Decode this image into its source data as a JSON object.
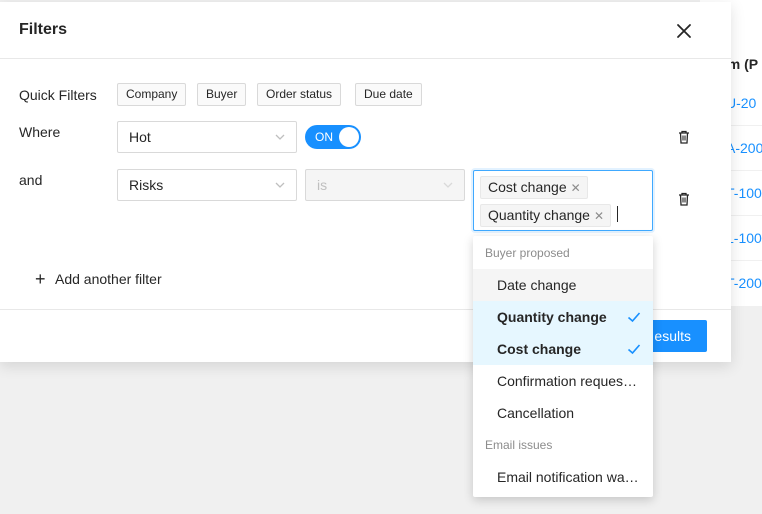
{
  "background": {
    "column_header": "em (P",
    "cells": [
      "U-20",
      "A-200",
      "T-100",
      "L-100",
      "T-200"
    ]
  },
  "modal": {
    "title": "Filters",
    "quick_filters": {
      "label": "Quick Filters",
      "chips": [
        "Company",
        "Buyer",
        "Order status",
        "Due date"
      ]
    },
    "where_row": {
      "label": "Where",
      "field": "Hot",
      "toggle": "ON"
    },
    "and_row": {
      "label": "and",
      "field": "Risks",
      "operator": "is",
      "tags": [
        "Cost change",
        "Quantity change"
      ]
    },
    "add_filter_label": "Add another filter",
    "results_button": "esults"
  },
  "dropdown": {
    "groups": [
      {
        "title": "Buyer proposed",
        "options": [
          {
            "label": "Date change",
            "state": "hover"
          },
          {
            "label": "Quantity change",
            "state": "selected"
          },
          {
            "label": "Cost change",
            "state": "selected"
          },
          {
            "label": "Confirmation reques…",
            "state": "normal"
          },
          {
            "label": "Cancellation",
            "state": "normal"
          }
        ]
      },
      {
        "title": "Email issues",
        "options": [
          {
            "label": "Email notification wa…",
            "state": "normal"
          }
        ]
      }
    ]
  },
  "colors": {
    "accent": "#1890ff",
    "selected_bg": "#e6f7ff"
  }
}
